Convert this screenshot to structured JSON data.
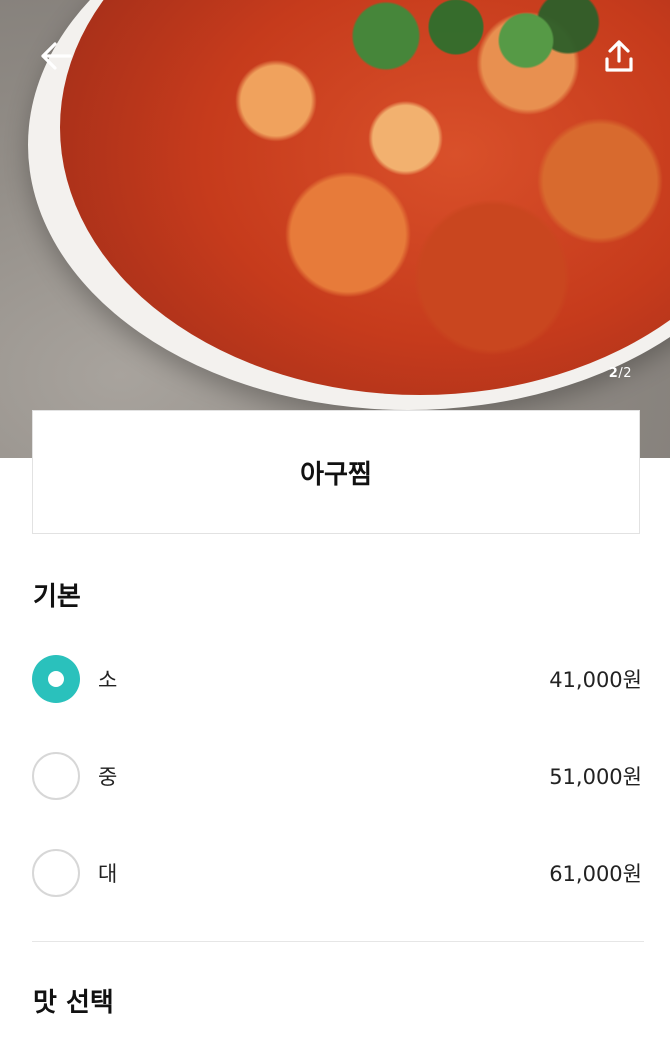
{
  "hero": {
    "counter_current": "2",
    "counter_total": "/2",
    "back_icon": "arrow-left-icon",
    "share_icon": "share-upload-icon"
  },
  "menu": {
    "name": "아구찜"
  },
  "sections": {
    "base": {
      "title": "기본",
      "options": [
        {
          "label": "소",
          "price": "41,000원",
          "selected": true
        },
        {
          "label": "중",
          "price": "51,000원",
          "selected": false
        },
        {
          "label": "대",
          "price": "61,000원",
          "selected": false
        }
      ]
    },
    "taste": {
      "title": "맛 선택"
    }
  },
  "colors": {
    "accent": "#2ac1bc",
    "radio_border": "#d7d7d7",
    "divider": "#e6e6e6"
  }
}
